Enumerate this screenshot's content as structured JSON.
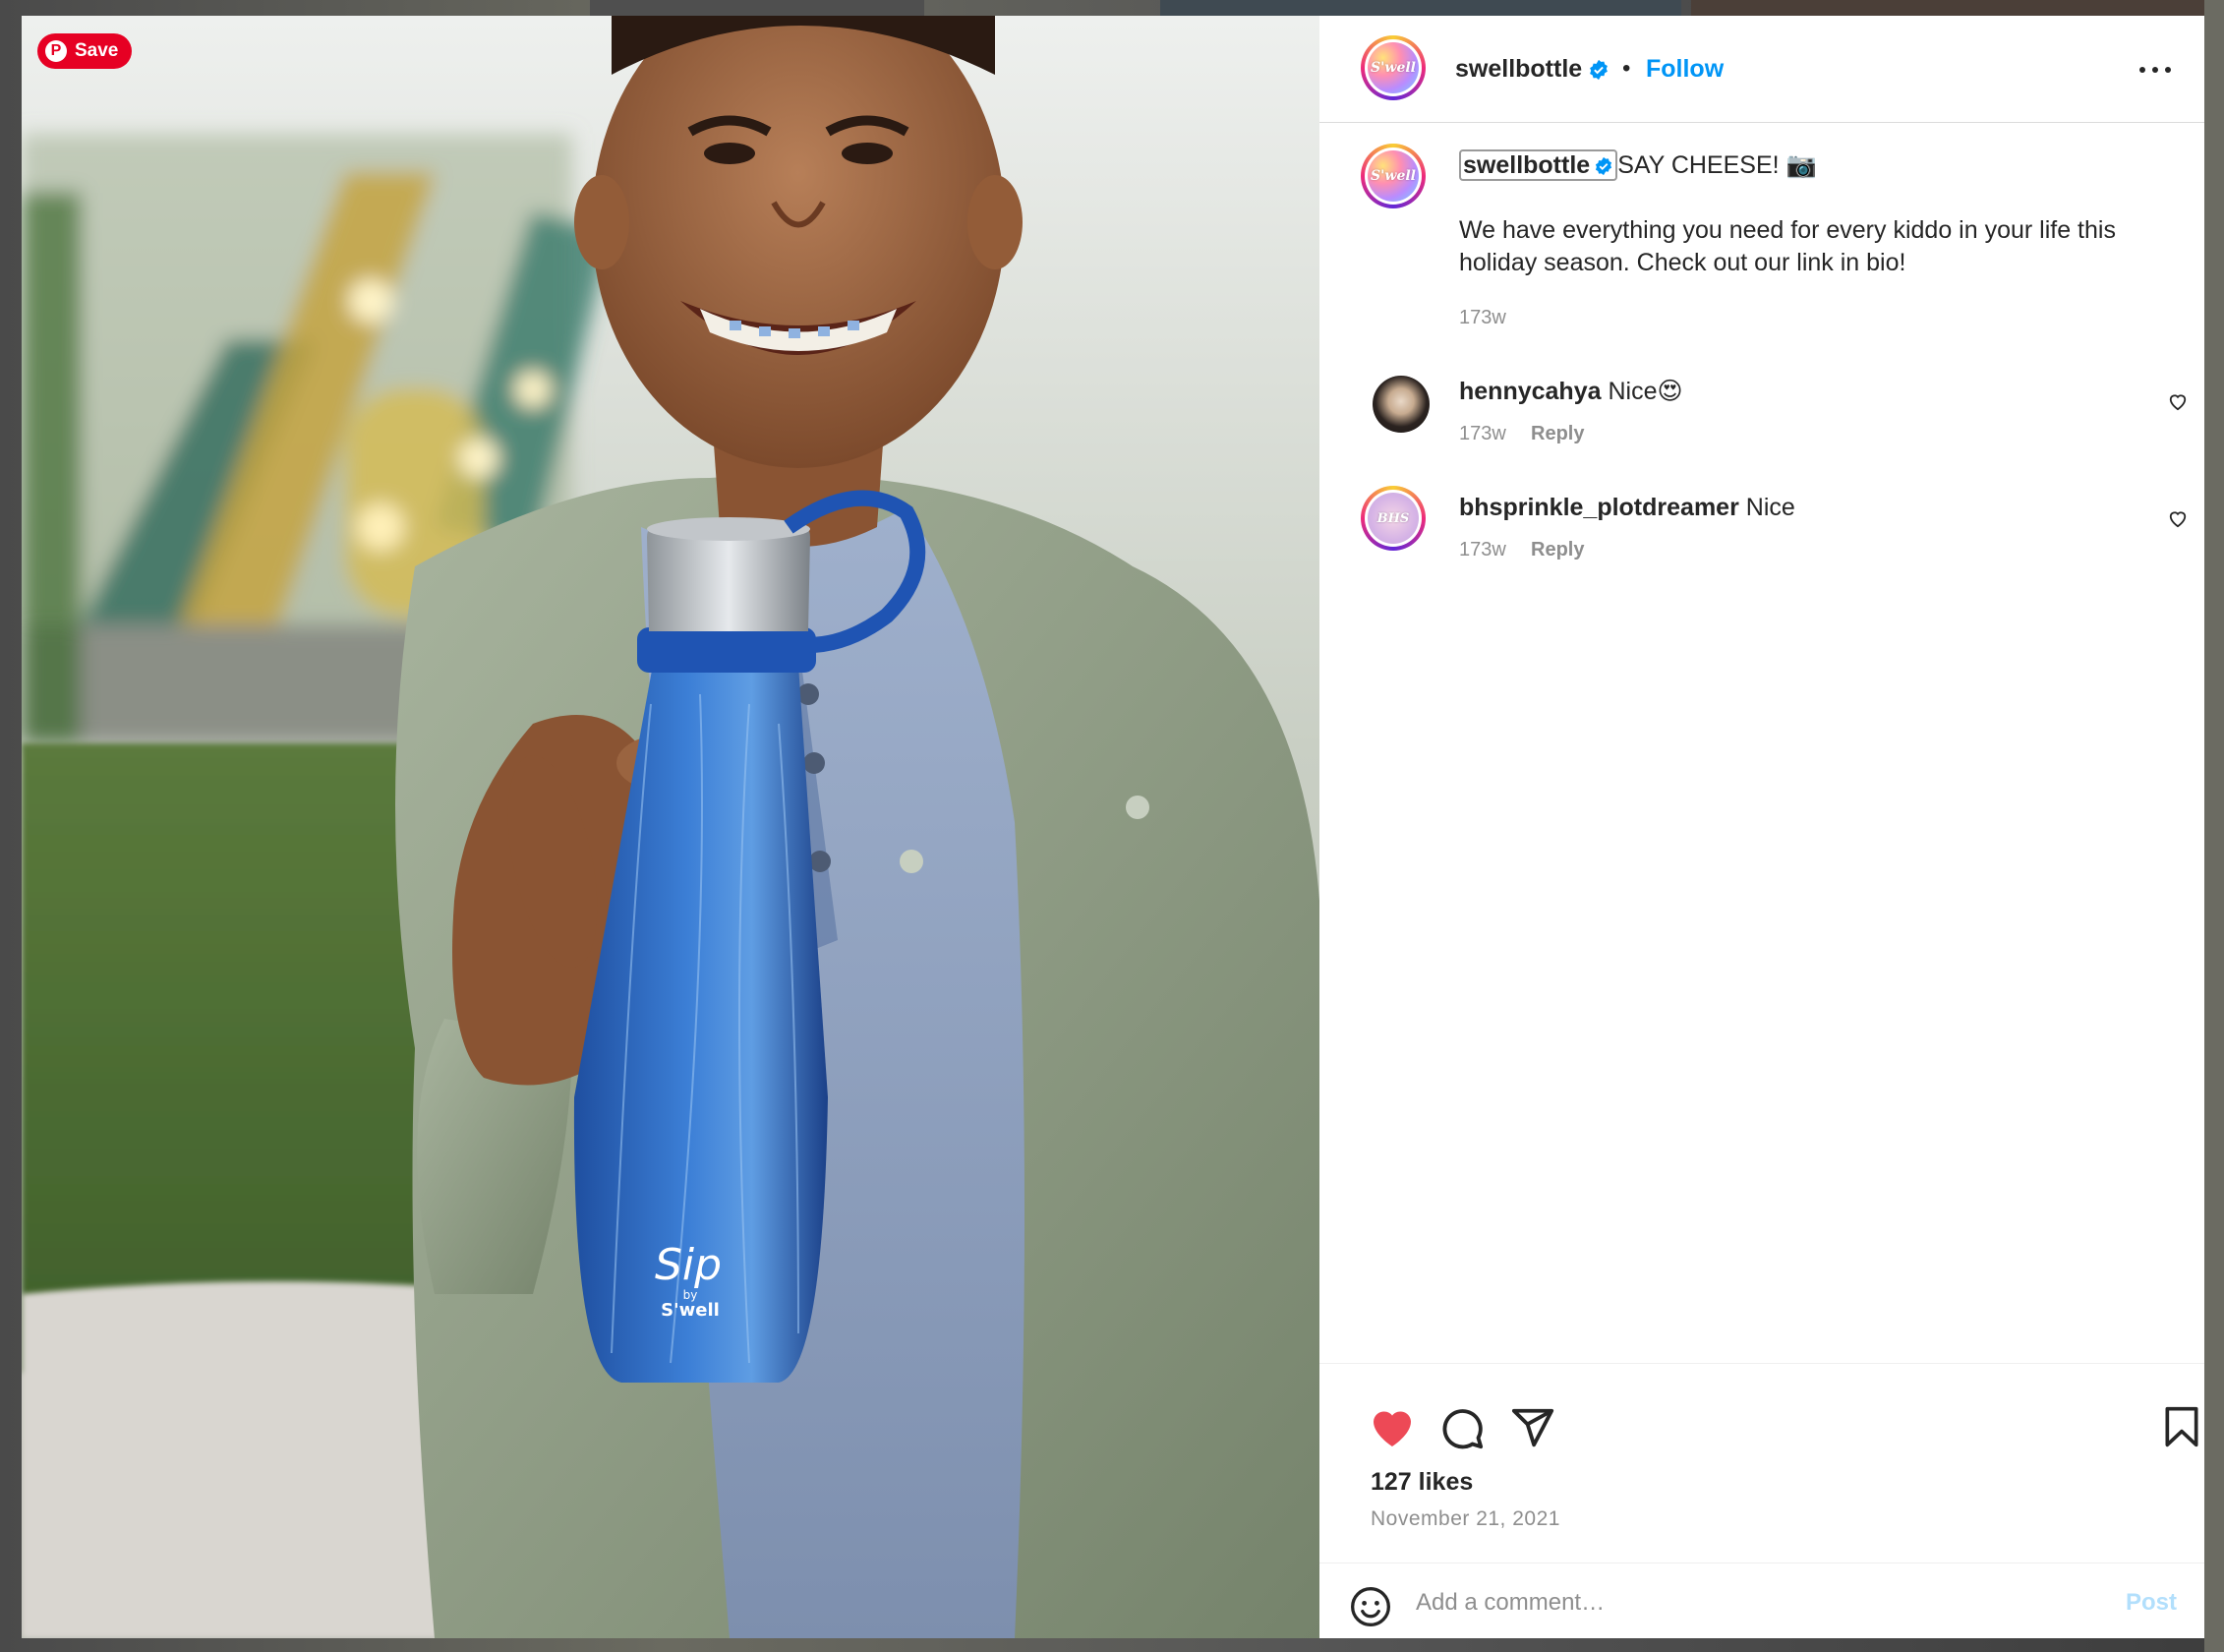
{
  "pin_save_label": "Save",
  "post": {
    "author": "swellbottle",
    "avatar_text": "S'well",
    "follow_label": "Follow",
    "separator": "•",
    "caption_headline": "SAY CHEESE! 📷",
    "caption_body_line1": "We have everything you need for every kiddo in your life this",
    "caption_body_line2": "holiday season. Check out our link in bio!",
    "caption_age": "173w",
    "bottle_brand_text_1": "Sip",
    "bottle_brand_text_2": "by",
    "bottle_brand_text_3": "S'well"
  },
  "comments": [
    {
      "user": "hennycahya",
      "text": "Nice😍",
      "age": "173w",
      "reply_label": "Reply"
    },
    {
      "user": "bhsprinkle_plotdreamer",
      "text": "Nice",
      "age": "173w",
      "reply_label": "Reply",
      "avatar_text": "BHS"
    }
  ],
  "footer": {
    "likes": "127 likes",
    "date": "November 21, 2021",
    "comment_placeholder": "Add a comment…",
    "post_label": "Post"
  },
  "colors": {
    "link_blue": "#0095f6",
    "like_red": "#ed4956",
    "pinterest_red": "#e60023",
    "verified_blue": "#0095f6"
  },
  "icons": [
    "pinterest-icon",
    "verified-badge-icon",
    "more-options-icon",
    "like-heart-filled-icon",
    "comment-icon",
    "share-icon",
    "bookmark-icon",
    "emoji-icon",
    "comment-like-icon"
  ]
}
